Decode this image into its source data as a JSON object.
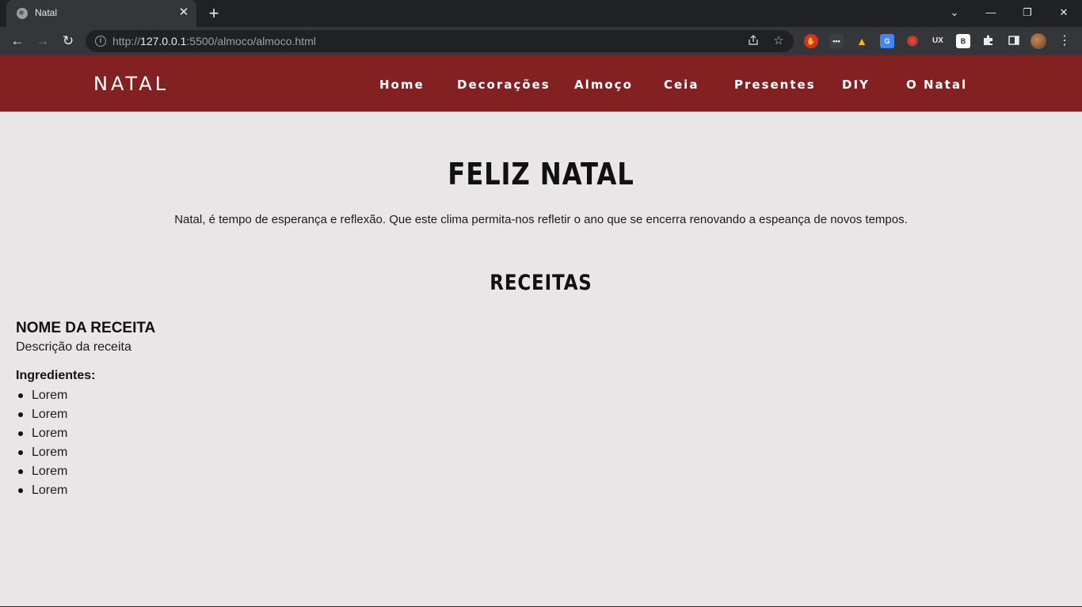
{
  "browser": {
    "tab_title": "Natal",
    "tab_close": "✕",
    "new_tab": "+",
    "url_scheme": "http://",
    "url_host": "127.0.0.1",
    "url_rest": ":5500/almoco/almoco.html",
    "window_controls": {
      "dropdown": "⌄",
      "minimize": "—",
      "restore": "❐",
      "close": "✕"
    },
    "nav": {
      "back": "←",
      "forward": "→",
      "reload": "↻"
    },
    "info_glyph": "i",
    "extensions": [
      {
        "name": "adblock-extension-icon",
        "glyph": "✋",
        "color": "#d93025"
      },
      {
        "name": "password-extension-icon",
        "glyph": "•••",
        "color": "#5f6368"
      },
      {
        "name": "drive-extension-icon",
        "glyph": "▲",
        "color": "#1e8e3e"
      },
      {
        "name": "translate-extension-icon",
        "glyph": "G",
        "color": "#4285f4"
      },
      {
        "name": "color-extension-icon",
        "glyph": "◉",
        "color": "#fbbc04"
      },
      {
        "name": "ux-extension-icon",
        "glyph": "UX",
        "color": "#202124"
      },
      {
        "name": "b-extension-icon",
        "glyph": "B",
        "color": "#ffffff"
      }
    ]
  },
  "site": {
    "logo": "NATAL",
    "menu": [
      "Home",
      "Decorações",
      "Almoço",
      "Ceia",
      "Presentes",
      "DIY",
      "O Natal"
    ],
    "title": "FELIZ NATAL",
    "intro": "Natal, é tempo de esperança e reflexão. Que este clima permita-nos refletir o ano que se encerra renovando a espeança de novos tempos.",
    "section_title": "RECEITAS",
    "recipe": {
      "name": "NOME DA RECEITA",
      "description": "Descrição da receita",
      "ingredients_label": "Ingredientes:",
      "ingredients": [
        "Lorem",
        "Lorem",
        "Lorem",
        "Lorem",
        "Lorem",
        "Lorem"
      ]
    }
  },
  "colors": {
    "header_bg": "#822022",
    "page_bg": "#e8e6e6",
    "chrome_dark": "#202124",
    "chrome_toolbar": "#35363a"
  }
}
